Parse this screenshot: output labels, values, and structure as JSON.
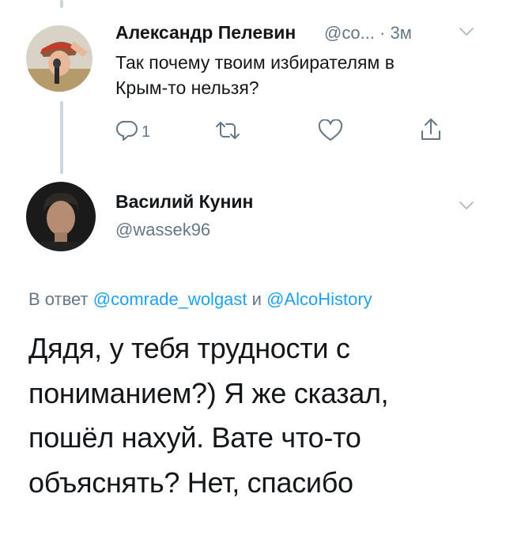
{
  "reply_tweet": {
    "author_name": "Александр Пелевин",
    "handle": "@co...",
    "separator": "·",
    "time": "3м",
    "text_lines": [
      "Так почему твоим избирателям в",
      "Крым-то нельзя?"
    ],
    "reply_count": "1",
    "icons": [
      "reply-icon",
      "retweet-icon",
      "like-icon",
      "share-icon",
      "chevron-down-icon"
    ]
  },
  "main_tweet": {
    "author_name": "Василий Кунин",
    "handle": "@wassek96",
    "reply_prefix": "В ответ",
    "mention_1": "@comrade_wolgast",
    "conjunction": "и",
    "mention_2": "@AlcoHistory",
    "text_lines": [
      "Дядя, у тебя трудности с",
      "пониманием?) Я же сказал,",
      "пошёл нахуй. Вате что-то",
      "объяснять? Нет, спасибо"
    ]
  },
  "colors": {
    "text": "#14171a",
    "secondary": "#657786",
    "link": "#1da1f2",
    "thread_line": "#ccd6dd"
  }
}
